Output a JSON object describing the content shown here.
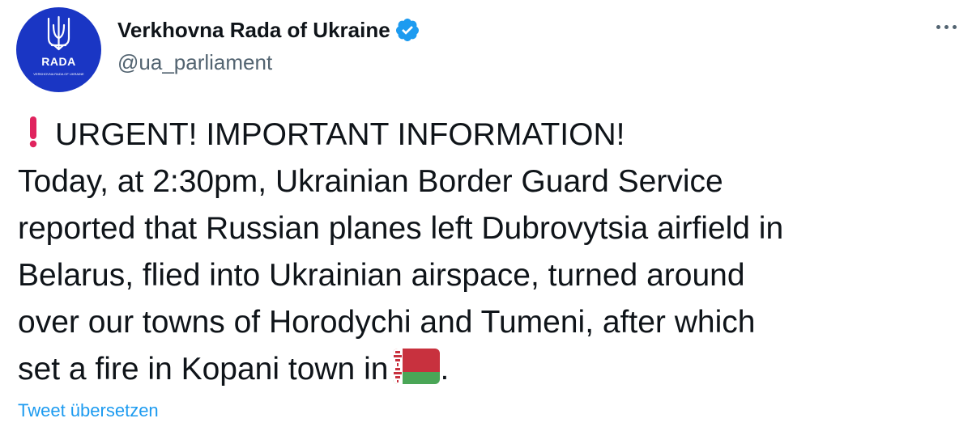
{
  "account": {
    "display_name": "Verkhovna Rada of Ukraine",
    "handle": "@ua_parliament",
    "verified": true,
    "avatar": {
      "logo_text": "RADA",
      "subtext": "VERKHOVNA RADA OF UKRAINE",
      "background": "#1a36c4",
      "icon": "trident-icon"
    }
  },
  "tweet": {
    "lines": [
      "URGENT! IMPORTANT INFORMATION!",
      "Today, at 2:30pm, Ukrainian Border Guard Service",
      "reported that Russian planes left Dubrovytsia airfield in",
      "Belarus, flied into Ukrainian airspace, turned around",
      "over our towns of Horodychi and Tumeni, after which",
      "set a fire in Kopani town in",
      "."
    ],
    "leading_emoji": "exclamation-mark-icon",
    "trailing_emoji": "belarus-flag-icon"
  },
  "actions": {
    "translate_label": "Tweet übersetzen",
    "more_icon": "more-options-icon"
  },
  "colors": {
    "text": "#0f1419",
    "secondary": "#536471",
    "link": "#1d9bf0",
    "verified": "#1d9bf0",
    "exclamation": "#e0245e",
    "flag_red": "#c8313e",
    "flag_green": "#4aa657"
  }
}
